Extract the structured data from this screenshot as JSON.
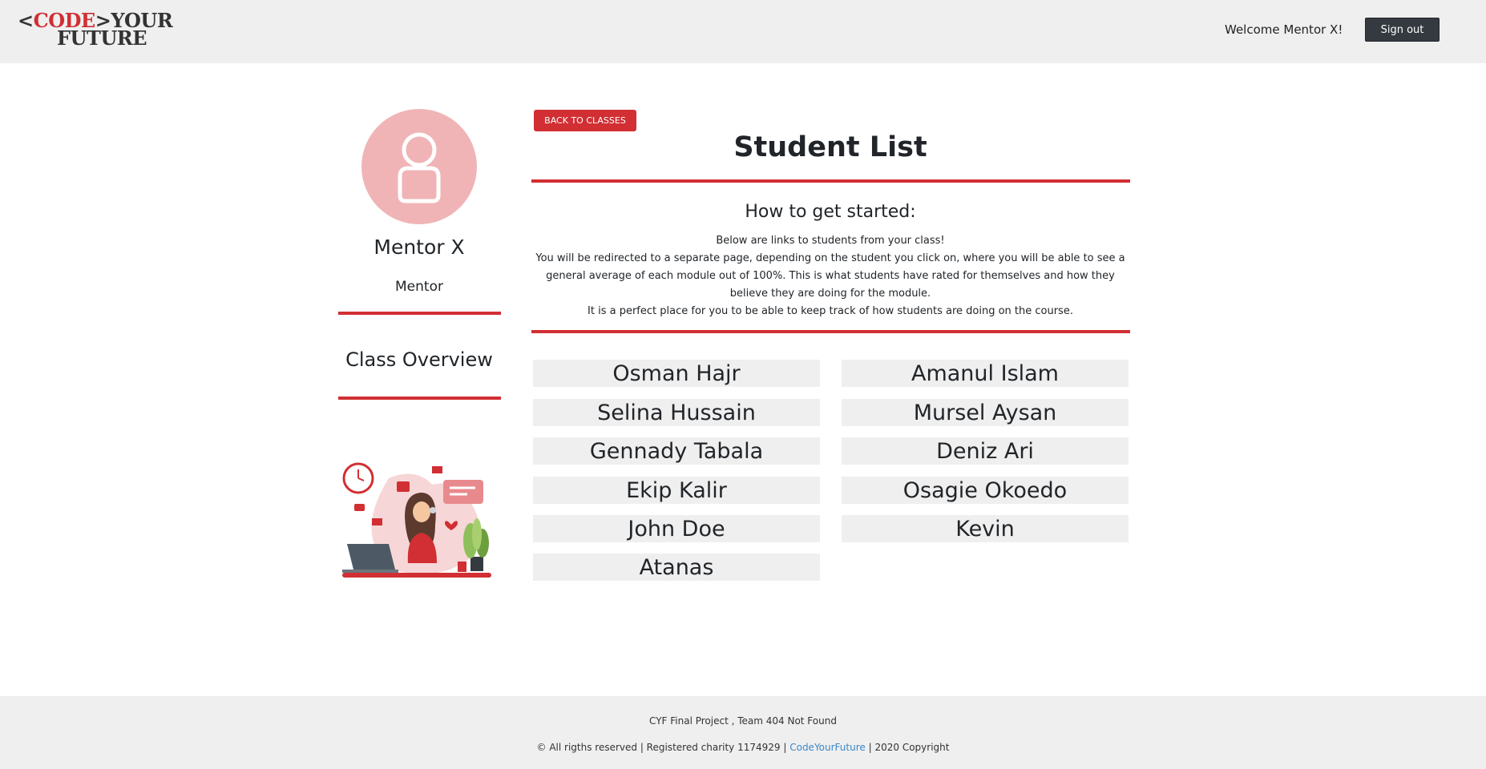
{
  "header": {
    "logo": {
      "open_bracket": "<",
      "code": "CODE",
      "close_bracket": ">",
      "your": "YOUR",
      "future": "FUTURE"
    },
    "welcome_text": "Welcome Mentor X!",
    "signout_label": "Sign out"
  },
  "sidebar": {
    "name": "Mentor X",
    "role": "Mentor",
    "class_overview": "Class Overview"
  },
  "main": {
    "back_button": "BACK TO CLASSES",
    "title": "Student List",
    "subtitle": "How to get started:",
    "instructions": {
      "line1": "Below are links to students from your class!",
      "line2": "You will be redirected to a separate page, depending on the student you click on, where you will be able to see a general average of each module out of 100%. This is what students have rated for themselves and how they believe they are doing for the module.",
      "line3": "It is a perfect place for you to be able to keep track of how students are doing on the course."
    },
    "students": [
      "Osman Hajr",
      "Amanul Islam",
      "Selina Hussain",
      "Mursel Aysan",
      "Gennady Tabala",
      "Deniz Ari",
      "Ekip Kalir",
      "Osagie Okoedo",
      "John Doe",
      "Kevin",
      "Atanas"
    ]
  },
  "footer": {
    "line1": "CYF Final Project , Team 404 Not Found",
    "rights": "© All rigths reserved | Registered charity 1174929 |",
    "link_text": "CodeYourFuture",
    "copyright": "| 2020 Copyright"
  },
  "colors": {
    "accent": "#d12f33",
    "header_bg": "#efefef",
    "signout_bg": "#343a40",
    "avatar_bg": "#f0b4b6",
    "link": "#3a87c8"
  }
}
